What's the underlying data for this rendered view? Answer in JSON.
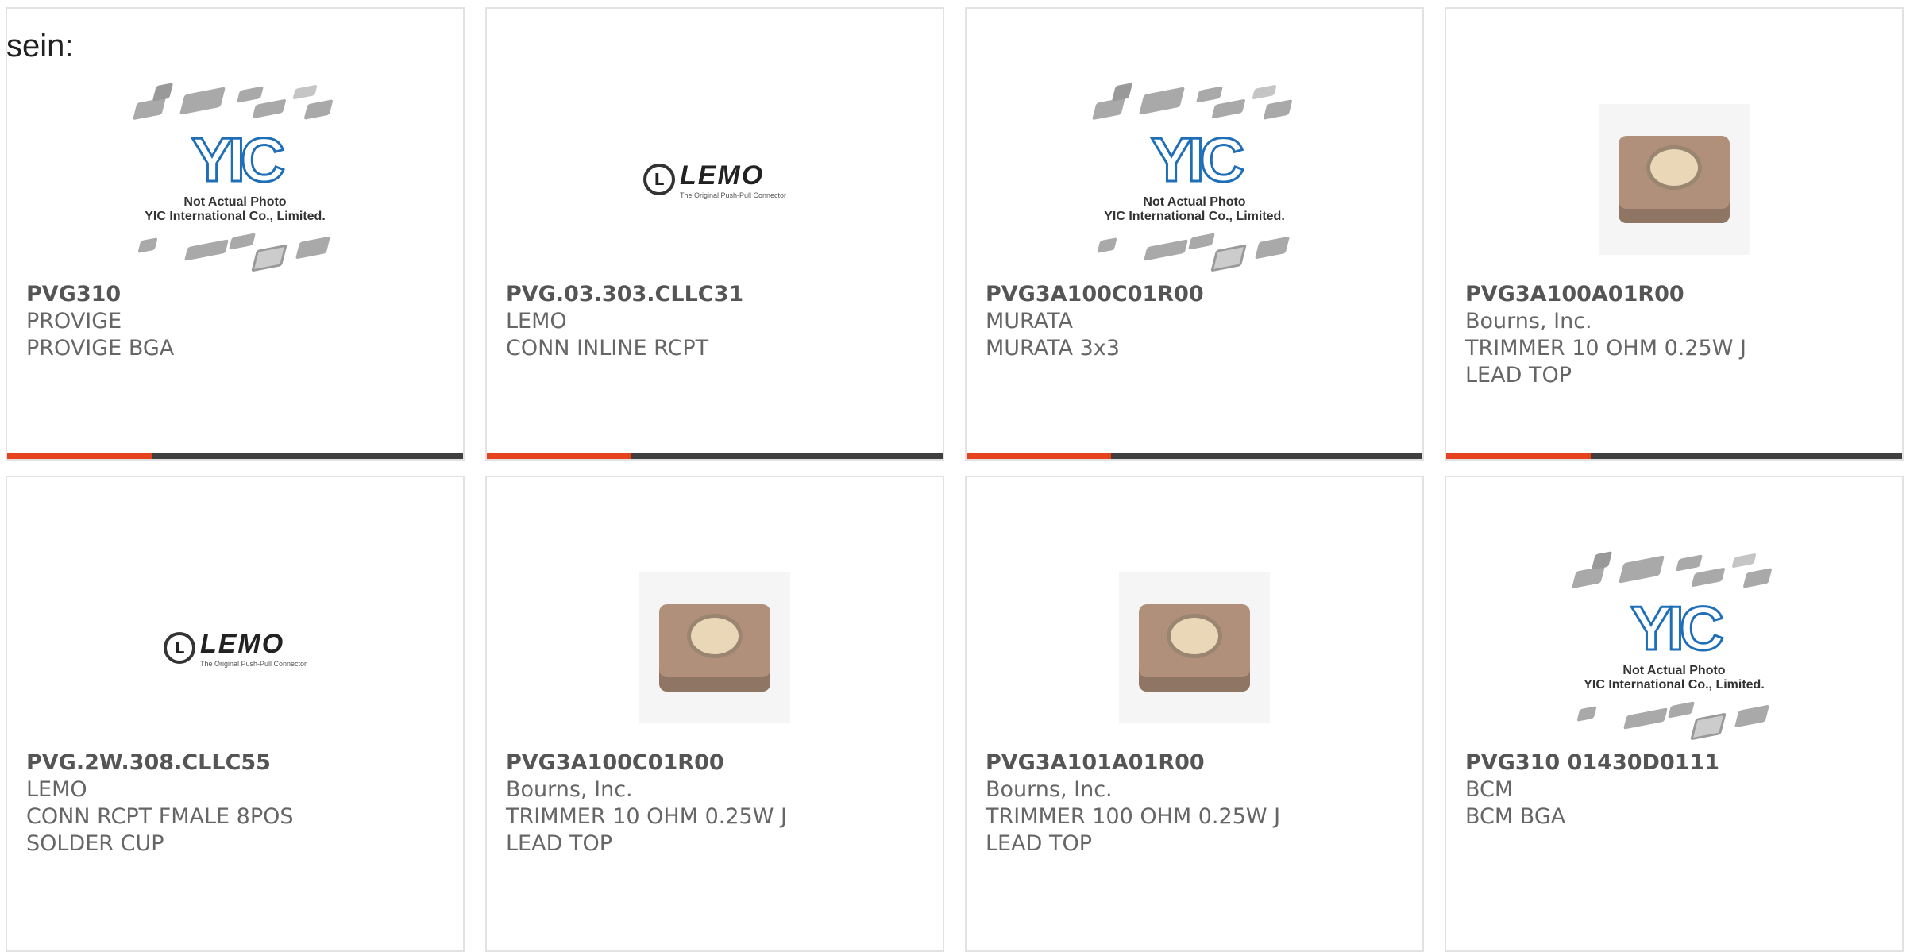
{
  "page_title": "sein:",
  "accent_color": "#e7421e",
  "bar_color": "#3f3f3f",
  "placeholder": {
    "caption_line1": "Not Actual Photo",
    "caption_line2": "YIC International Co., Limited.",
    "brand_mark": "YIC"
  },
  "lemo": {
    "word": "LEMO",
    "tagline": "The Original Push-Pull Connector"
  },
  "cards": [
    {
      "part": "PVG310",
      "manufacturer": "PROVIGE",
      "desc": "PROVIGE BGA",
      "image": "yic-placeholder"
    },
    {
      "part": "PVG.03.303.CLLC31",
      "manufacturer": "LEMO",
      "desc": "CONN INLINE RCPT",
      "image": "lemo-logo"
    },
    {
      "part": "PVG3A100C01R00",
      "manufacturer": "MURATA",
      "desc": "MURATA 3x3",
      "image": "yic-placeholder"
    },
    {
      "part": "PVG3A100A01R00",
      "manufacturer": "Bourns, Inc.",
      "desc": "TRIMMER 10 OHM 0.25W J LEAD TOP",
      "image": "trimmer-photo"
    },
    {
      "part": "PVG.2W.308.CLLC55",
      "manufacturer": "LEMO",
      "desc": "CONN RCPT FMALE 8POS SOLDER CUP",
      "image": "lemo-logo"
    },
    {
      "part": "PVG3A100C01R00",
      "manufacturer": "Bourns, Inc.",
      "desc": "TRIMMER 10 OHM 0.25W J LEAD TOP",
      "image": "trimmer-photo"
    },
    {
      "part": "PVG3A101A01R00",
      "manufacturer": "Bourns, Inc.",
      "desc": "TRIMMER 100 OHM 0.25W J LEAD TOP",
      "image": "trimmer-photo"
    },
    {
      "part": "PVG310 01430D0111",
      "manufacturer": "BCM",
      "desc": "BCM BGA",
      "image": "yic-placeholder"
    }
  ]
}
